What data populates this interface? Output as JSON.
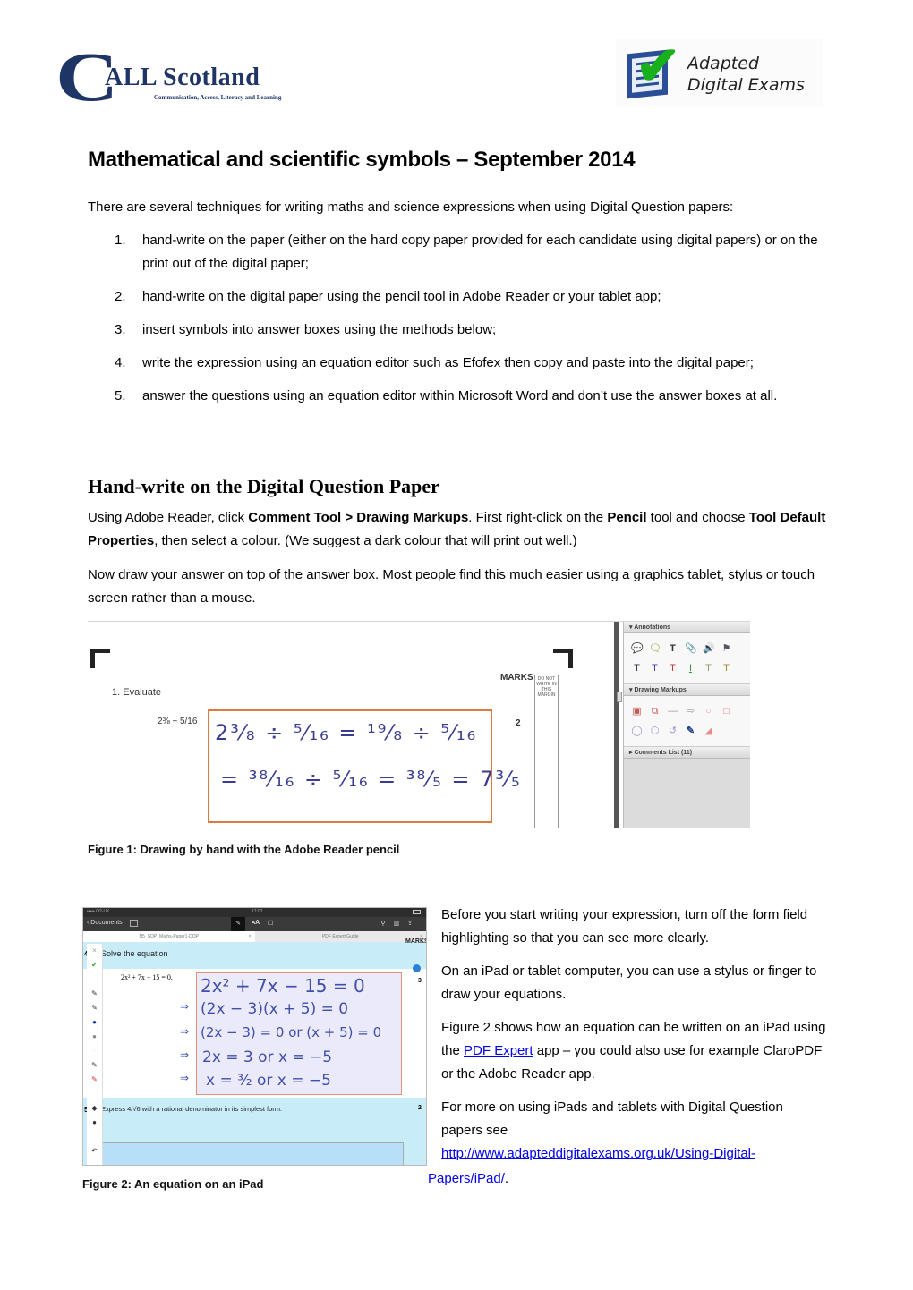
{
  "logos": {
    "call_scotland": {
      "initial": "C",
      "name": "ALL Scotland",
      "tagline": "Communication, Access, Literacy and Learning",
      "color": "#1f3566"
    },
    "adapted_digital_exams": {
      "line1": "Adapted",
      "line2": "Digital Exams",
      "check_color": "#19b11b",
      "box_color": "#2a4f96"
    }
  },
  "title": "Mathematical and scientific symbols – September 2014",
  "intro": "There are several techniques for writing maths and science expressions when using Digital Question papers:",
  "methods": [
    {
      "num": "1.",
      "text": "hand-write on the paper (either on the hard copy paper provided for each candidate using digital papers) or on the print out of the digital paper;"
    },
    {
      "num": "2.",
      "text": "hand-write on the digital paper using the pencil tool in Adobe Reader or your tablet app;"
    },
    {
      "num": "3.",
      "text": "insert symbols into answer boxes using the methods below;"
    },
    {
      "num": "4.",
      "text": "write the expression using an equation editor such as Efofex then copy and paste into the digital paper;"
    },
    {
      "num": "5.",
      "text": "answer the questions using an equation editor within Microsoft Word and don’t use the answer boxes at all."
    }
  ],
  "section": {
    "heading": "Hand-write on the Digital Question Paper",
    "para1": {
      "t1": "Using Adobe Reader, click ",
      "b1": "Comment Tool > Drawing Markups",
      "t2": ". First right-click on the ",
      "b2": "Pencil",
      "t3": " tool and choose ",
      "b3": "Tool Default Properties",
      "t4": ", then select a colour. (We suggest a dark colour that will print out well.)"
    },
    "para2": "Now draw your answer on top of the answer box. Most people find this much easier using a graphics tablet, stylus or touch screen rather than a mouse."
  },
  "figure1": {
    "question_label": "1.   Evaluate",
    "question_expr": "2⅜ ÷ 5/16",
    "marks_header": "MARKS",
    "margin_note": "DO NOT WRITE IN THIS MARGIN",
    "mark_value": "2",
    "handwriting_line1": "2³⁄₈ ÷ ⁵⁄₁₆  =  ¹⁹⁄₈ ÷ ⁵⁄₁₆",
    "handwriting_line2": "= ³⁸⁄₁₆ ÷ ⁵⁄₁₆ = ³⁸⁄₅ = 7³⁄₅",
    "panel": {
      "annotations_label": "Annotations",
      "drawing_markups_label": "Drawing Markups",
      "comments_list_label": "Comments List (11)"
    },
    "caption": "Figure 1: Drawing by hand with the Adobe Reader pencil"
  },
  "figure2": {
    "status_carrier": "••••• O2-UK",
    "status_time": "17:02",
    "back_label": "Documents",
    "tab_active": "N5_SQP_Maths-Paper1-DQP",
    "tab_inactive": "PDF Expert Guide",
    "q4_number": "4",
    "q4_text": "Solve the equation",
    "q4_marks_header": "MARKS",
    "q4_given": "2x² + 7x − 15 = 0.",
    "q4_mark": "3",
    "handwriting": [
      "2x² + 7x − 15 = 0",
      "(2x − 3)(x + 5) = 0",
      "(2x − 3) = 0  or  (x + 5) = 0",
      "2x = 3   or   x = −5",
      "x = ³⁄₂   or   x = −5"
    ],
    "q5_number": "5",
    "q5_text": "Express  4/√6  with a rational denominator in its simplest form.",
    "q5_mark": "2",
    "caption": "Figure 2: An equation on an iPad"
  },
  "sidebar_text": {
    "p1": "Before you start writing your expression, turn off the form field highlighting so that you can see more clearly.",
    "p2": "On an iPad or tablet computer, you can use a stylus or finger to draw your equations.",
    "p3_before": "Figure 2 shows how an equation can be written on an iPad using the ",
    "p3_link": "PDF Expert",
    "p3_after": " app – you could also use for example ClaroPDF or the Adobe Reader app.",
    "p4_before": "For more on using iPads and tablets with Digital Question papers see",
    "p4_link_line1": "http://www.adapteddigitalexams.org.uk/Using-Digital-",
    "p4_link_line2": "Papers/iPad/",
    "p4_after": "."
  },
  "colors": {
    "link": "#0000ee",
    "answer_box_border": "#e07a3c",
    "handwriting": "#3a3c8f",
    "ipad_highlight": "#c9ecf9"
  }
}
